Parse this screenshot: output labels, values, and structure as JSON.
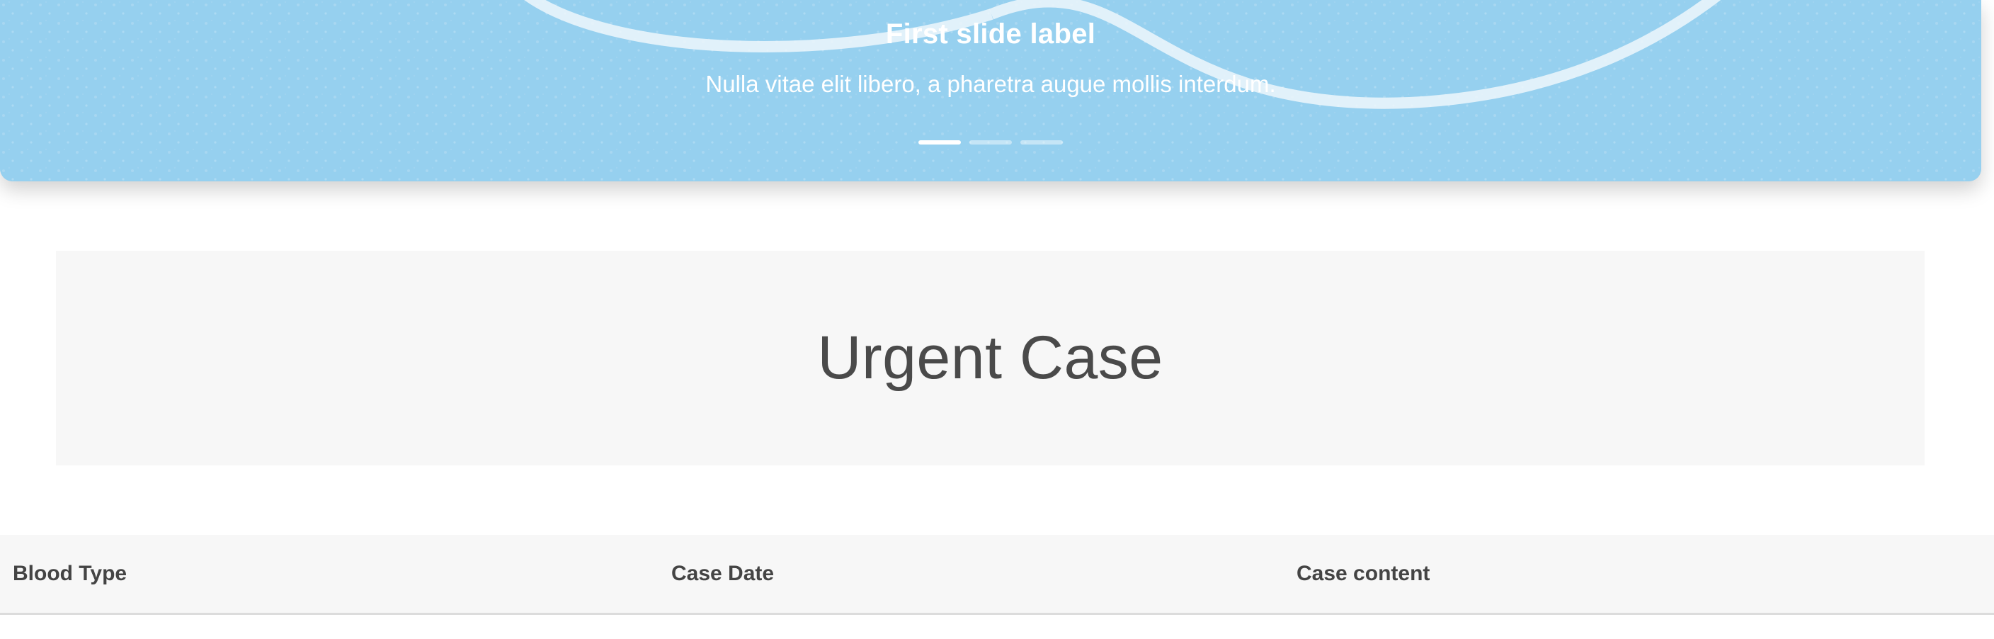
{
  "carousel": {
    "slide_title": "First slide label",
    "slide_text": "Nulla vitae elit libero, a pharetra augue mollis interdum.",
    "indicators": [
      {
        "label": "Slide 1",
        "active": true
      },
      {
        "label": "Slide 2",
        "active": false
      },
      {
        "label": "Slide 3",
        "active": false
      }
    ],
    "background_color": "#96d0ef"
  },
  "jumbotron": {
    "title": "Urgent Case"
  },
  "table": {
    "columns": [
      "Blood Type",
      "Case Date",
      "Case content"
    ]
  }
}
